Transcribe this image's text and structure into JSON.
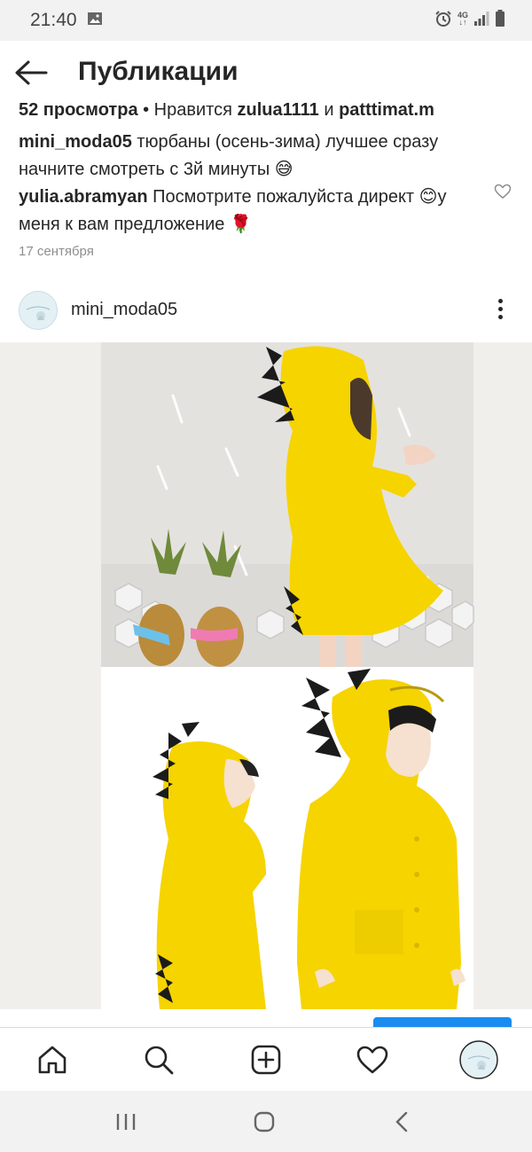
{
  "status_bar": {
    "time": "21:40",
    "network": "4G"
  },
  "header": {
    "title": "Публикации"
  },
  "likes": {
    "views": "52 просмотра",
    "separator": " • Нравится ",
    "user1": "zulua1111",
    "conj": " и ",
    "user2": "patttimat.m"
  },
  "caption": {
    "username": "mini_moda05",
    "text": " тюрбаны (осень-зима) лучшее сразу начните смотреть с 3й минуты 😅"
  },
  "comment": {
    "username": "yulia.abramyan",
    "text": " Посмотрите пожалуйста директ 😊у меня к вам предложение 🌹"
  },
  "date": "17 сентября",
  "post": {
    "username": "mini_moda05"
  },
  "icons": {
    "back": "arrow-left-icon",
    "home": "home-icon",
    "search": "search-icon",
    "add": "add-post-icon",
    "activity": "heart-icon",
    "profile": "avatar"
  },
  "colors": {
    "accent_blue": "#1a8cf0",
    "raincoat_yellow": "#f5d200"
  }
}
